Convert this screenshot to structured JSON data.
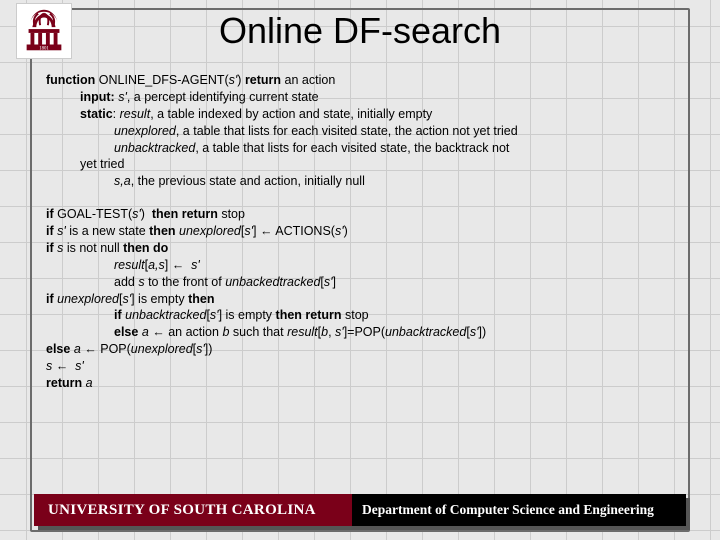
{
  "title": "Online DF-search",
  "lines": [
    {
      "html": "<span class='b'>function</span> ONLINE_DFS-AGENT(<span class='i'>s'</span>) <span class='b'>return</span> an action",
      "cls": ""
    },
    {
      "html": "<span class='b'>input:</span> <span class='i'>s'</span>, a percept identifying current state",
      "cls": "ind1"
    },
    {
      "html": "<span class='b'>static</span>: <span class='i'>result</span>, a table indexed by action and state, initially empty",
      "cls": "ind1"
    },
    {
      "html": "<span class='i'>unexplored</span>, a table that lists for each visited state, the action not yet tried",
      "cls": "ind2"
    },
    {
      "html": "<span class='i'>unbacktracked</span>, a table that lists for each visited state, the backtrack not",
      "cls": "ind2"
    },
    {
      "html": "yet tried",
      "cls": "ind1"
    },
    {
      "html": "<span class='i'>s,a</span>, the previous state and action, initially null",
      "cls": "ind2"
    }
  ],
  "lines2": [
    {
      "html": "<span class='b'>if</span> GOAL-TEST(<span class='i'>s'</span>)  <span class='b'>then return</span> stop",
      "cls": ""
    },
    {
      "html": "<span class='b'>if</span> <span class='i'>s'</span> is a new state <span class='b'>then</span> <span class='i'>unexplored</span>[<span class='i'>s'</span>] ← ACTIONS(<span class='i'>s'</span>)",
      "cls": ""
    },
    {
      "html": "<span class='b'>if</span> <span class='i'>s</span> is not null <span class='b'>then do</span>",
      "cls": ""
    },
    {
      "html": "<span class='i'>result</span>[<span class='i'>a,s</span>] ←  <span class='i'>s'</span>",
      "cls": "ind2"
    },
    {
      "html": "add <span class='i'>s</span> to the front of <span class='i'>unbackedtracked</span>[<span class='i'>s'</span>]",
      "cls": "ind2"
    },
    {
      "html": "<span class='b'>if</span> <span class='i'>unexplored</span>[<span class='i'>s'</span>] is empty <span class='b'>then</span>",
      "cls": ""
    },
    {
      "html": "<span class='b'>if</span> <span class='i'>unbacktracked</span>[<span class='i'>s'</span>] is empty <span class='b'>then return</span> stop",
      "cls": "ind2"
    },
    {
      "html": "<span class='b'>else</span> <span class='i'>a</span> ← an action <span class='i'>b</span> such that <span class='i'>result</span>[<span class='i'>b</span>, <span class='i'>s'</span>]=POP(<span class='i'>unbacktracked</span>[<span class='i'>s'</span>])",
      "cls": "ind2"
    },
    {
      "html": "<span class='b'>else</span> <span class='i'>a</span> ← POP(<span class='i'>unexplored</span>[<span class='i'>s'</span>])",
      "cls": ""
    },
    {
      "html": "<span class='i'>s</span> ←  <span class='i'>s'</span>",
      "cls": ""
    },
    {
      "html": "<span class='b'>return</span> <span class='i'>a</span>",
      "cls": ""
    }
  ],
  "footer": {
    "university": "UNIVERSITY OF SOUTH CAROLINA",
    "department": "Department of Computer Science and Engineering"
  }
}
